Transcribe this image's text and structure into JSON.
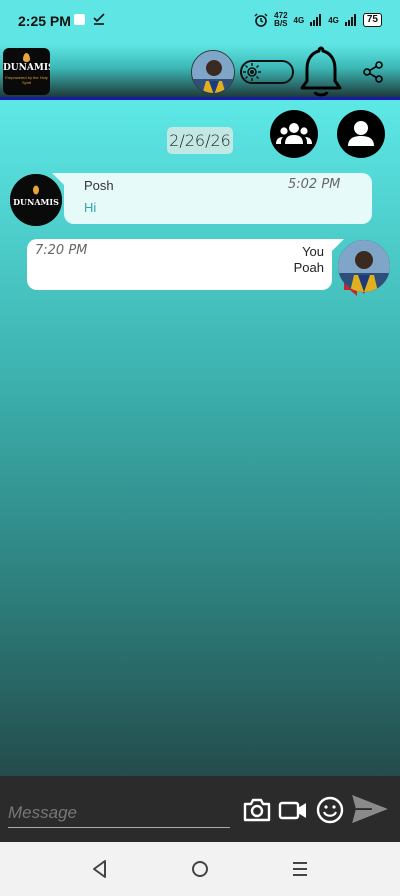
{
  "status_bar": {
    "time": "2:25 PM",
    "net_speed_value": "472",
    "net_speed_unit": "B/S",
    "network_1": "4G",
    "network_2": "4G",
    "battery": "75"
  },
  "header": {
    "logo_text": "DUNAMIS",
    "logo_subtext": "Empowered by the Holy Spirit"
  },
  "chat": {
    "date": "2/26/26",
    "messages": [
      {
        "sender": "Posh",
        "text": "Hi",
        "time": "5:02 PM",
        "direction": "incoming"
      },
      {
        "sender": "You",
        "text": "Poah",
        "time": "7:20 PM",
        "direction": "outgoing"
      }
    ]
  },
  "composer": {
    "placeholder": "Message"
  },
  "icons": {
    "status": [
      "photo-icon",
      "download-check-icon",
      "alarm-icon",
      "signal-icon",
      "battery-icon"
    ],
    "header": [
      "app-logo",
      "avatar",
      "theme-toggle",
      "bell-icon",
      "share-icon"
    ],
    "chat": [
      "group-icon",
      "person-icon",
      "speaker-icon"
    ],
    "composer": [
      "camera-icon",
      "video-icon",
      "emoji-icon",
      "send-icon"
    ],
    "nav": [
      "back-icon",
      "home-icon",
      "menu-icon"
    ]
  },
  "colors": {
    "accent_cyan": "#5fe6e4",
    "header_border": "#1a1aa8",
    "speaker_red": "#c62828"
  }
}
